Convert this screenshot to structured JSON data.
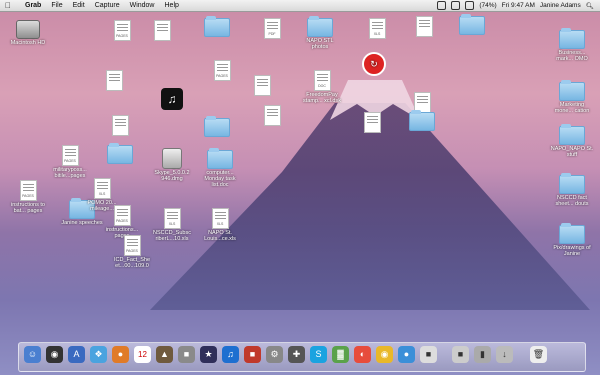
{
  "menubar": {
    "apple_glyph": "",
    "menus": [
      "Grab",
      "File",
      "Edit",
      "Capture",
      "Window",
      "Help"
    ],
    "battery": "(74%)",
    "clock": "Fri 9:47 AM",
    "user": "Janine Adams",
    "search_icon": "search-icon"
  },
  "desktop": {
    "macintosh_hd": "Macintosh HD",
    "left_column": [
      "instructions to bat... pages",
      "Janine speeches",
      "militaryposs... bitile...pages",
      "POMO 20... mileage..."
    ],
    "right_column": [
      "Business... mark... OMO",
      "Marketing mone... cation",
      "NAPO_NAPO St. stuff",
      "NSCCD fact sheet... douts",
      "Pix/drawings of Janine"
    ],
    "center": [
      "Skype_5.0.0.2 946.dmg",
      "NSCCD_Subsc riberL...10.xls",
      "NAPO St. Louis...ce.xls",
      "computer... Monday task list.doc",
      "instructions... pages",
      "NAPO STL photos",
      "FreedomPay stamp... xcl.dsk",
      "ICD_Fact_She et...00...109.0"
    ]
  },
  "dock": {
    "items": [
      "finder-icon",
      "dashboard-icon",
      "app-store-icon",
      "safari-icon",
      "firefox-icon",
      "calendar-icon",
      "photos-icon",
      "itunes-icon",
      "photo-booth-icon",
      "preferences-icon",
      "skype-icon",
      "evernote-icon",
      "spotify-icon",
      "chrome-icon",
      "twitter-icon",
      "stamp-icon",
      "finder-folder-icon",
      "trash-icon"
    ]
  },
  "colors": {
    "accent": "#4aa3df",
    "sky_top": "#c98aa6",
    "mountain": "#4a3c6e"
  }
}
